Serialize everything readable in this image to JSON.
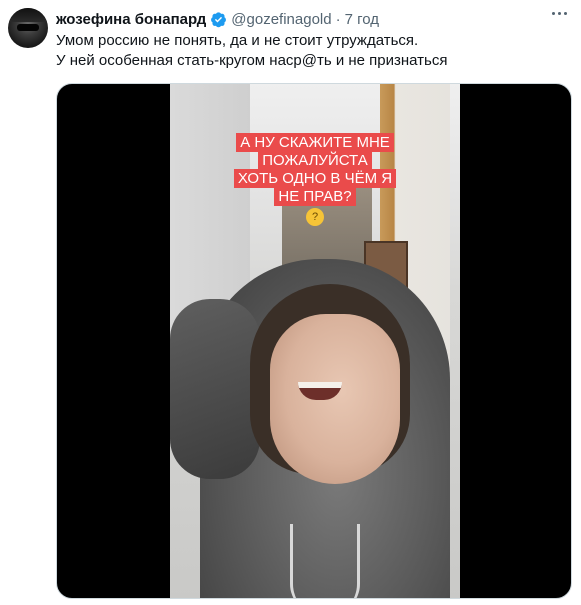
{
  "author": {
    "display_name": "жозефина бонапард",
    "handle": "@gozefinagold",
    "time": "7 год"
  },
  "tweet": {
    "lines": [
      "Умом россию не понять, да и не стоит утруждаться.",
      "У ней особенная стать-кругом наср@ть и не признаться"
    ]
  },
  "media": {
    "caption_lines": [
      "А НУ СКАЖИТЕ МНЕ",
      "ПОЖАЛУЙСТА",
      "ХОТЬ ОДНО В ЧЁМ Я",
      "НЕ ПРАВ?"
    ],
    "emoji": "thinking-face"
  },
  "colors": {
    "verified": "#1d9bf0",
    "caption_bg": "#ea4b4b",
    "text_secondary": "#536471"
  }
}
